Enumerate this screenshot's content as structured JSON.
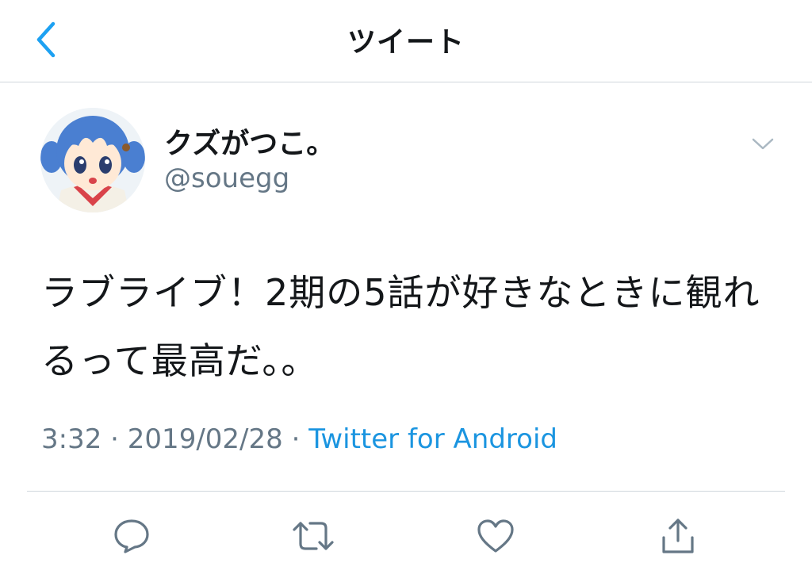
{
  "header": {
    "title": "ツイート",
    "back_icon": "chevron-left-icon"
  },
  "tweet": {
    "author": {
      "display_name": "クズがつこ。",
      "handle": "@souegg",
      "avatar": "anime-girl-avatar"
    },
    "text": "ラブライブ！2期の5話が好きなときに観れるって最高だ。。",
    "time": "3:32",
    "separator1": " · ",
    "date": "2019/02/28",
    "separator2": " · ",
    "source": "Twitter for Android"
  },
  "actions": [
    {
      "name": "reply",
      "icon": "reply-icon"
    },
    {
      "name": "retweet",
      "icon": "retweet-icon"
    },
    {
      "name": "like",
      "icon": "heart-icon"
    },
    {
      "name": "share",
      "icon": "share-icon"
    }
  ],
  "colors": {
    "accent": "#1da1f2",
    "link": "#1b95e0",
    "text": "#14171a",
    "secondary": "#657786",
    "icon": "#657786",
    "divider": "#cfd6dc"
  }
}
